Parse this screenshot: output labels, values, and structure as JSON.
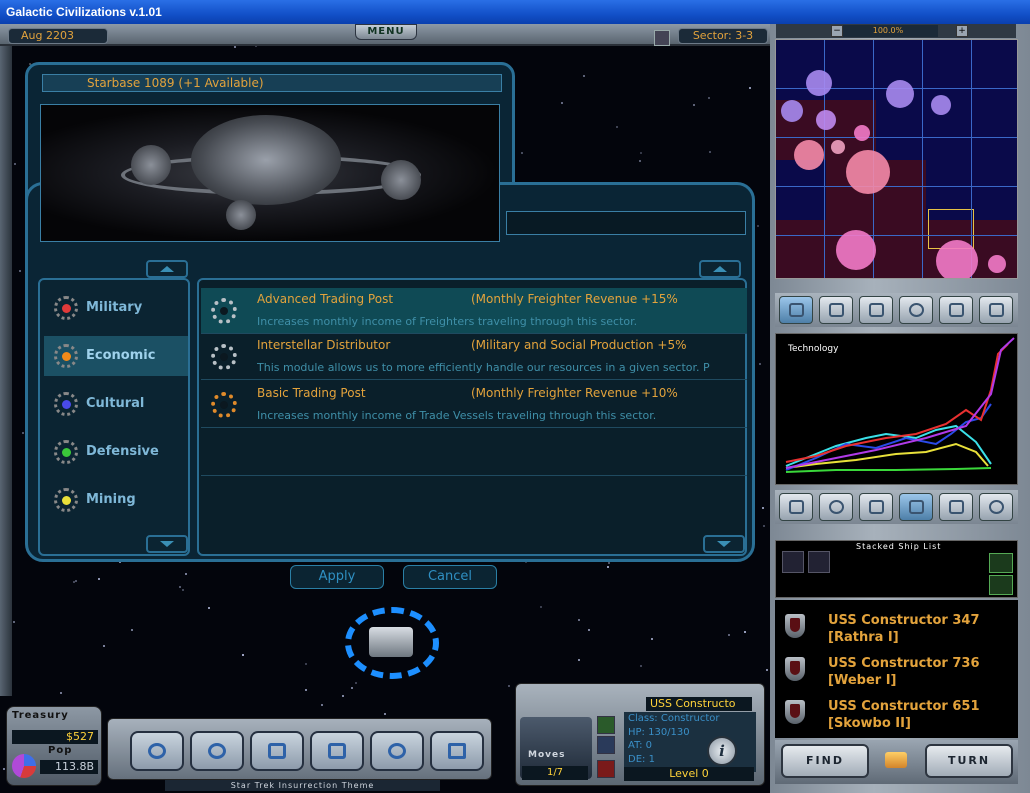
{
  "window": {
    "title": "Galactic Civilizations v.1.01"
  },
  "topbar": {
    "date": "Aug 2203",
    "menu_label": "MENU",
    "sector": "Sector: 3-3"
  },
  "dialog": {
    "title": "Starbase 1089 (+1 Available)",
    "categories": [
      {
        "label": "Military",
        "color": "#e03a3a"
      },
      {
        "label": "Economic",
        "color": "#f08a1a"
      },
      {
        "label": "Cultural",
        "color": "#4a4ae8"
      },
      {
        "label": "Defensive",
        "color": "#3ac83a"
      },
      {
        "label": "Mining",
        "color": "#e8e03a"
      }
    ],
    "selected_category": "Economic",
    "modules": [
      {
        "name": "Advanced Trading Post",
        "effect": "(Monthly Freighter Revenue +15%",
        "description": "Increases monthly income of Freighters traveling through this sector."
      },
      {
        "name": "Interstellar Distributor",
        "effect": "(Military and Social Production +5%",
        "description": "This module allows us to more efficiently handle our resources in a given sector. P"
      },
      {
        "name": "Basic Trading Post",
        "effect": "(Monthly Freighter Revenue +10%",
        "description": "Increases monthly income of Trade Vessels traveling through this sector."
      }
    ],
    "apply_label": "Apply",
    "cancel_label": "Cancel"
  },
  "minimap": {
    "zoom": "100.0%",
    "minus": "−",
    "plus": "+"
  },
  "graph": {
    "label": "Technology"
  },
  "stacked": {
    "label": "Stacked Ship List"
  },
  "ships": [
    {
      "name": "USS Constructor 347",
      "location": "[Rathra I]"
    },
    {
      "name": "USS Constructor 736",
      "location": "[Weber I]"
    },
    {
      "name": "USS Constructor 651",
      "location": "[Skowbo II]"
    }
  ],
  "buttons": {
    "find": "FIND",
    "turn": "TURN"
  },
  "hud": {
    "treasury_label": "Treasury",
    "treasury_value": "$527",
    "pop_label": "Pop",
    "pop_value": "113.8B",
    "music": "Star Trek Insurrection Theme",
    "moves_label": "Moves",
    "moves_value": "1/7",
    "unit_name": "USS Constructo",
    "unit_class": "Class: Constructor",
    "unit_hp": "HP: 130/130",
    "unit_at": "AT: 0",
    "unit_de": "DE: 1",
    "unit_level": "Level 0",
    "info_glyph": "i"
  }
}
